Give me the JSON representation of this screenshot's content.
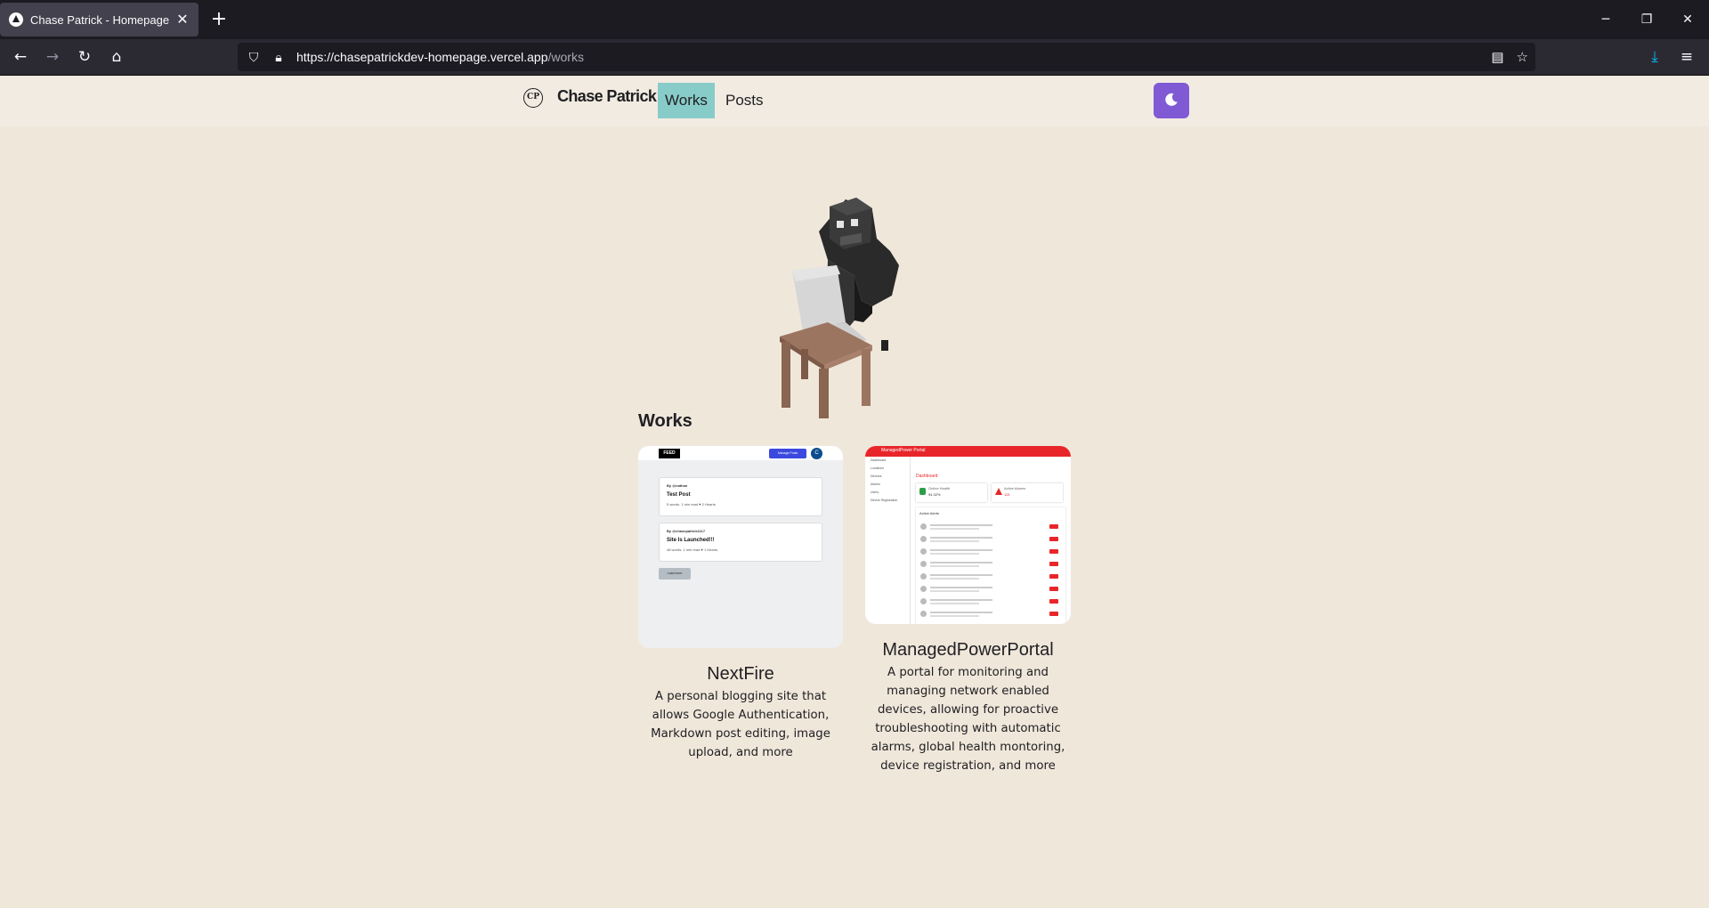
{
  "browser": {
    "tab_title": "Chase Patrick - Homepage",
    "new_tab": "+",
    "url_host": "https://chasepatrickdev-homepage.vercel.app",
    "url_path": "/works"
  },
  "site": {
    "logo_initials": "CP",
    "title": "Chase Patrick",
    "nav": [
      "Works",
      "Posts"
    ],
    "active_nav": "Works",
    "theme_button_color": "#805ad5"
  },
  "works_section": {
    "heading": "Works",
    "items": [
      {
        "title": "NextFire",
        "description": "A personal blogging site that allows Google Authentication, Markdown post editing, image upload, and more",
        "thumb": {
          "feed_label": "FEED",
          "manage_label": "Manage Posts",
          "avatar_letter": "C",
          "posts": [
            {
              "by": "By @nathan",
              "title": "Test Post",
              "meta": "5 words. 1 min read ♥ 2 Hearts"
            },
            {
              "by": "By @chasepatrick1117",
              "title": "Site Is Launched!!!",
              "meta": "48 words. 1 min read ♥ 1 Hearts"
            }
          ],
          "load_more": "Load more"
        }
      },
      {
        "title": "ManagedPowerPortal",
        "description": "A portal for monitoring and managing network enabled devices, allowing for proactive troubleshooting with automatic alarms, global health montoring, device registration, and more",
        "thumb": {
          "app_title": "ManagedPower Portal",
          "sidebar": [
            "Dashboard",
            "Locations",
            "Devices",
            "Alarms",
            "Users",
            "Device Registration"
          ],
          "dashboard_label": "Dashboard",
          "kpi_1_label": "Online Health",
          "kpi_1_value": "94.32%",
          "kpi_2_label": "Active Alarms",
          "kpi_2_value": "115",
          "alerts_label": "Active Alerts"
        }
      }
    ]
  },
  "colors": {
    "page_bg": "#f0e7db",
    "header_bg": "#f2ebe1",
    "active_nav_bg": "#88ccca"
  }
}
